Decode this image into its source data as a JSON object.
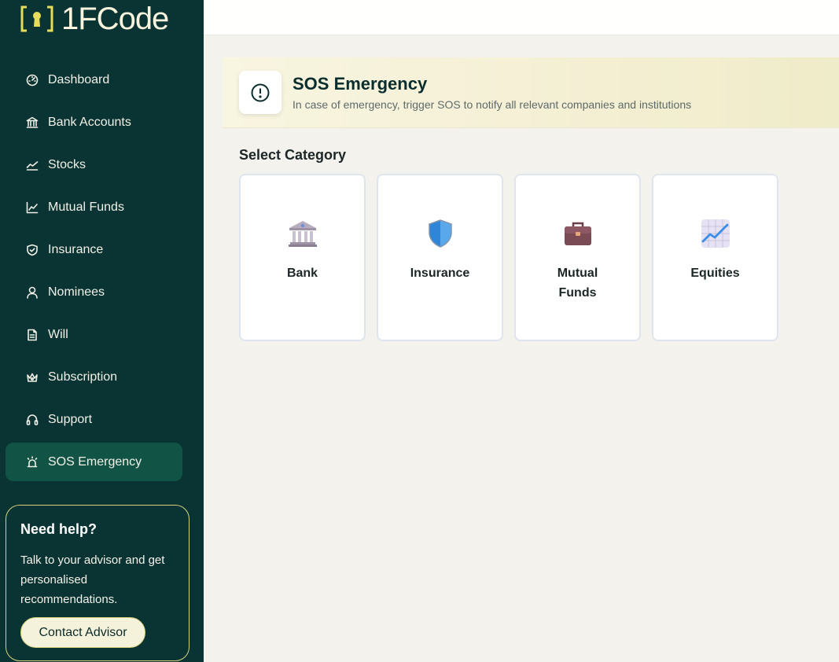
{
  "brand": {
    "name": "1FCode"
  },
  "sidebar": {
    "items": [
      {
        "label": "Dashboard",
        "icon": "dashboard-icon"
      },
      {
        "label": "Bank Accounts",
        "icon": "bank-icon"
      },
      {
        "label": "Stocks",
        "icon": "stocks-icon"
      },
      {
        "label": "Mutual Funds",
        "icon": "chart-icon"
      },
      {
        "label": "Insurance",
        "icon": "shield-icon"
      },
      {
        "label": "Nominees",
        "icon": "user-icon"
      },
      {
        "label": "Will",
        "icon": "document-icon"
      },
      {
        "label": "Subscription",
        "icon": "crown-icon"
      },
      {
        "label": "Support",
        "icon": "headset-icon"
      },
      {
        "label": "SOS Emergency",
        "icon": "alarm-icon",
        "active": true
      }
    ],
    "help": {
      "title": "Need help?",
      "text": "Talk to your advisor and get personalised recommendations.",
      "button": "Contact Advisor"
    }
  },
  "hero": {
    "title": "SOS Emergency",
    "subtitle": "In case of emergency, trigger SOS to notify all relevant companies and institutions",
    "icon": "alert-circle-icon"
  },
  "main": {
    "section_title": "Select Category",
    "categories": [
      {
        "label": "Bank",
        "icon": "bank-building-icon"
      },
      {
        "label": "Insurance",
        "icon": "shield-icon"
      },
      {
        "label": "Mutual Funds",
        "icon": "briefcase-icon"
      },
      {
        "label": "Equities",
        "icon": "chart-up-icon"
      }
    ]
  },
  "colors": {
    "sidebar_bg": "#0a3433",
    "active_bg": "#115446",
    "accent": "#d6d27a",
    "page_bg": "#f3f2ec"
  }
}
